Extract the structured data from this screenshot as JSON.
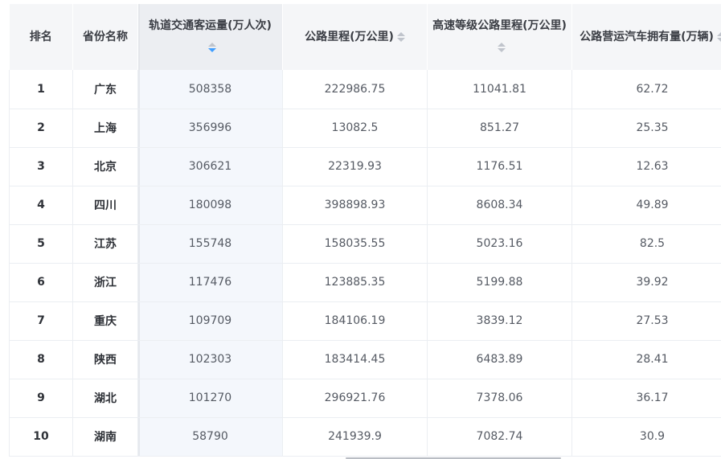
{
  "table": {
    "columns": [
      {
        "label": "排名",
        "sortable": false
      },
      {
        "label": "省份名称",
        "sortable": false
      },
      {
        "label": "轨道交通客运量(万人次)",
        "sortable": true,
        "sort_state": "descending"
      },
      {
        "label": "公路里程(万公里)",
        "sortable": true,
        "sort_state": "none"
      },
      {
        "label": "高速等级公路里程(万公里)",
        "sortable": true,
        "sort_state": "none"
      },
      {
        "label": "公路营运汽车拥有量(万辆)",
        "sortable": true,
        "sort_state": "none"
      }
    ],
    "rows": [
      {
        "rank": "1",
        "province": "广东",
        "rail": "508358",
        "road": "222986.75",
        "highway": "11041.81",
        "vehicles": "62.72"
      },
      {
        "rank": "2",
        "province": "上海",
        "rail": "356996",
        "road": "13082.5",
        "highway": "851.27",
        "vehicles": "25.35"
      },
      {
        "rank": "3",
        "province": "北京",
        "rail": "306621",
        "road": "22319.93",
        "highway": "1176.51",
        "vehicles": "12.63"
      },
      {
        "rank": "4",
        "province": "四川",
        "rail": "180098",
        "road": "398898.93",
        "highway": "8608.34",
        "vehicles": "49.89"
      },
      {
        "rank": "5",
        "province": "江苏",
        "rail": "155748",
        "road": "158035.55",
        "highway": "5023.16",
        "vehicles": "82.5"
      },
      {
        "rank": "6",
        "province": "浙江",
        "rail": "117476",
        "road": "123885.35",
        "highway": "5199.88",
        "vehicles": "39.92"
      },
      {
        "rank": "7",
        "province": "重庆",
        "rail": "109709",
        "road": "184106.19",
        "highway": "3839.12",
        "vehicles": "27.53"
      },
      {
        "rank": "8",
        "province": "陕西",
        "rail": "102303",
        "road": "183414.45",
        "highway": "6483.89",
        "vehicles": "28.41"
      },
      {
        "rank": "9",
        "province": "湖北",
        "rail": "101270",
        "road": "296921.76",
        "highway": "7378.06",
        "vehicles": "36.17"
      },
      {
        "rank": "10",
        "province": "湖南",
        "rail": "58790",
        "road": "241939.9",
        "highway": "7082.74",
        "vehicles": "30.9"
      }
    ]
  },
  "colors": {
    "header_bg": "#f5f6f8",
    "sorted_column_bg": "#f4f7fc",
    "active_sort_arrow": "#409eff",
    "inactive_sort_arrow": "#c0c4cc"
  },
  "icons": {
    "sort": "sort-caret-icon"
  }
}
